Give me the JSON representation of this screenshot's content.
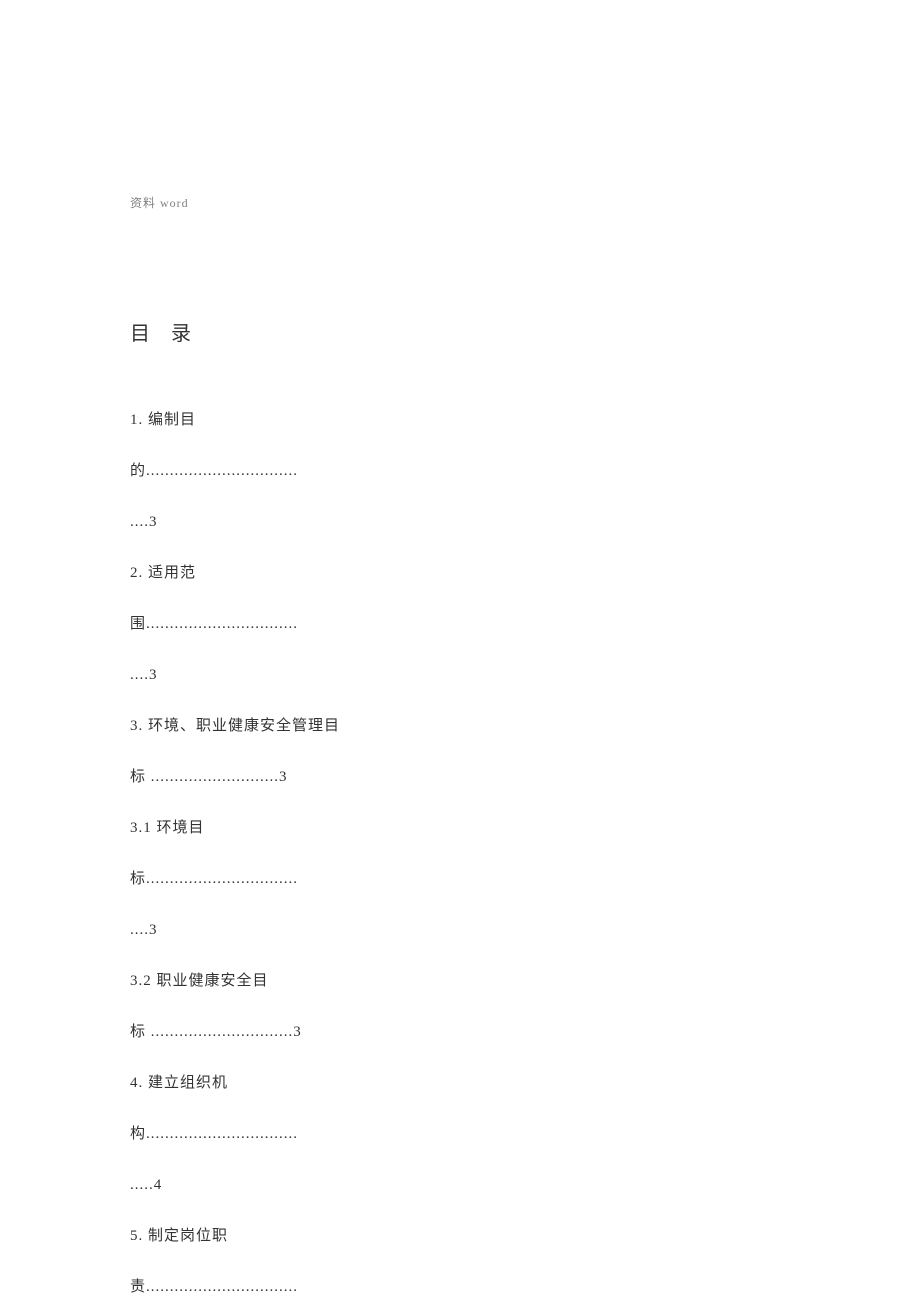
{
  "header": {
    "label": "资料 word"
  },
  "title": "目 录",
  "toc": {
    "line1": "1. 编制目",
    "line2": "的................................",
    "line3": " ....3",
    "line4": "2. 适用范",
    "line5": "围................................",
    "line6": " ....3",
    "line7": "3.   环境、职业健康安全管理目",
    "line8": "标 ...........................3",
    "line9": "3.1 环境目",
    "line10": "标................................",
    "line11": "....3",
    "line12": "3.2 职业健康安全目",
    "line13": "标 ..............................3",
    "line14": "4. 建立组织机",
    "line15": "构................................",
    "line16": ".....4",
    "line17": "5. 制定岗位职",
    "line18": "责................................"
  }
}
